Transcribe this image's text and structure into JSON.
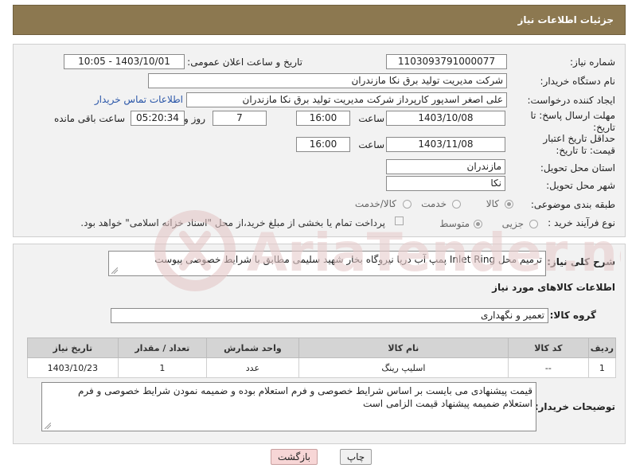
{
  "header": {
    "title": "جزئیات اطلاعات نیاز"
  },
  "need_number": {
    "label": "شماره نیاز:",
    "value": "1103093791000077"
  },
  "announce_date": {
    "label": "تاریخ و ساعت اعلان عمومی:",
    "value": "1403/10/01 - 10:05"
  },
  "buyer_org": {
    "label": "نام دستگاه خریدار:",
    "value": "شرکت مدیریت تولید برق نکا  مازندران"
  },
  "requester": {
    "label": "ایجاد کننده درخواست:",
    "value": "علی اصغر اسدپور کارپرداز شرکت مدیریت تولید برق نکا  مازندران",
    "contact_link": "اطلاعات تماس خریدار"
  },
  "reply_deadline": {
    "label": "مهلت ارسال پاسخ: تا تاریخ:",
    "date": "1403/10/08",
    "time_label": "ساعت",
    "time": "16:00",
    "days": "7",
    "days_label": "روز و",
    "remaining": "05:20:34",
    "remaining_label": "ساعت باقی مانده"
  },
  "price_validity": {
    "label": "حداقل تاریخ اعتبار قیمت: تا تاریخ:",
    "date": "1403/11/08",
    "time_label": "ساعت",
    "time": "16:00"
  },
  "delivery_province": {
    "label": "استان محل تحویل:",
    "value": "مازندران"
  },
  "delivery_city": {
    "label": "شهر محل تحویل:",
    "value": "نکا"
  },
  "category": {
    "label": "طبقه بندی موضوعی:",
    "options": [
      "کالا",
      "خدمت",
      "کالا/خدمت"
    ]
  },
  "process_type": {
    "label": "نوع فرآیند خرید :",
    "options": [
      "جزیی",
      "متوسط"
    ],
    "payment_note": "پرداخت تمام یا بخشی از مبلغ خرید،از محل \"اسناد خزانه اسلامی\" خواهد بود."
  },
  "description": {
    "label": "شرح کلی نیاز:",
    "value": "ترمیم محل Inlet Ring پمپ آب دریا نیروگاه بخار شهید سلیمی  مطابق با شرایط خصوصی  پیوست"
  },
  "goods_info": {
    "title": "اطلاعات کالاهای مورد نیاز"
  },
  "goods_group": {
    "label": "گروه کالا:",
    "value": "تعمیر و نگهداری"
  },
  "table": {
    "headers": [
      "ردیف",
      "کد کالا",
      "نام کالا",
      "واحد شمارش",
      "تعداد / مقدار",
      "تاریخ نیاز"
    ],
    "rows": [
      {
        "row": "1",
        "code": "--",
        "name": "اسلیپ رینگ",
        "unit": "عدد",
        "qty": "1",
        "date": "1403/10/23"
      }
    ]
  },
  "buyer_notes": {
    "label": "توضیحات خریدار:",
    "value": "قیمت پیشنهادی می بایست بر اساس شرایط خصوصی و فرم استعلام بوده و ضمیمه نمودن شرایط خصوصی و فرم استعلام ضمیمه پیشنهاد قیمت الزامی است"
  },
  "buttons": {
    "print": "چاپ",
    "back": "بازگشت"
  },
  "watermark": {
    "text": "AriaTender.neT"
  },
  "colors": {
    "header_bg": "#8c7850",
    "panel_bg": "#f2f2f2",
    "link": "#2a56a8",
    "back_btn_bg": "#f7d6d6",
    "watermark": "#e7cccc"
  }
}
